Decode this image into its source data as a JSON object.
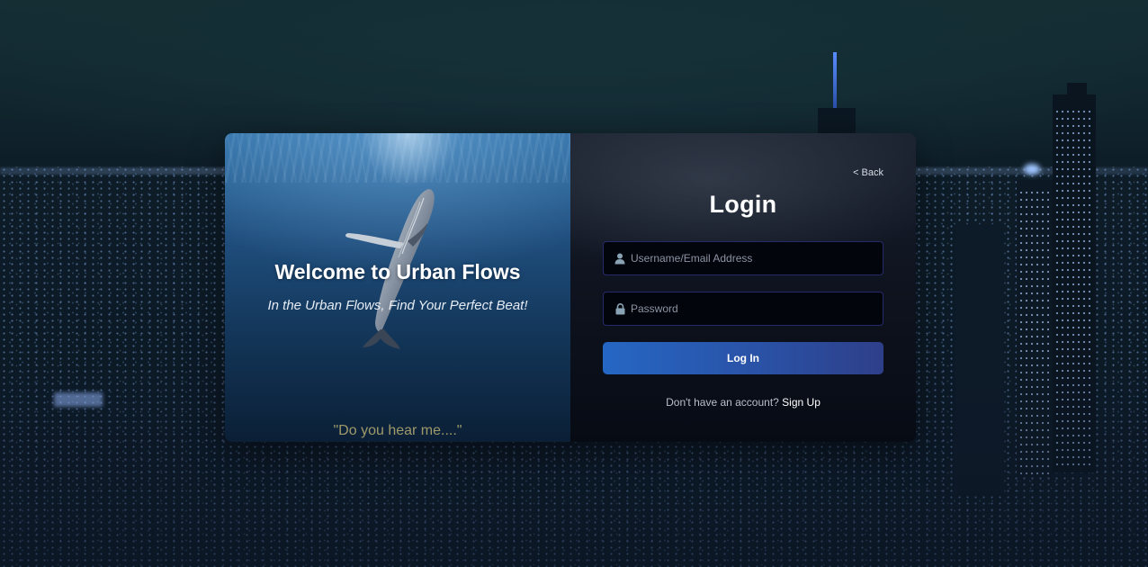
{
  "welcome": {
    "title": "Welcome to Urban Flows",
    "subtitle": "In the Urban Flows, Find Your Perfect Beat!",
    "quote": "\"Do you hear me....\""
  },
  "login": {
    "back_label": "< Back",
    "title": "Login",
    "username_placeholder": "Username/Email Address",
    "password_placeholder": "Password",
    "button_label": "Log In",
    "signup_prompt": "Don't have an account?",
    "signup_label": "Sign Up"
  },
  "icons": {
    "username": "user-icon",
    "password": "lock-icon"
  },
  "colors": {
    "button_start": "#2567c4",
    "button_end": "#2e3f8a",
    "field_border": "#252a6a",
    "quote": "#9e9a6a"
  }
}
